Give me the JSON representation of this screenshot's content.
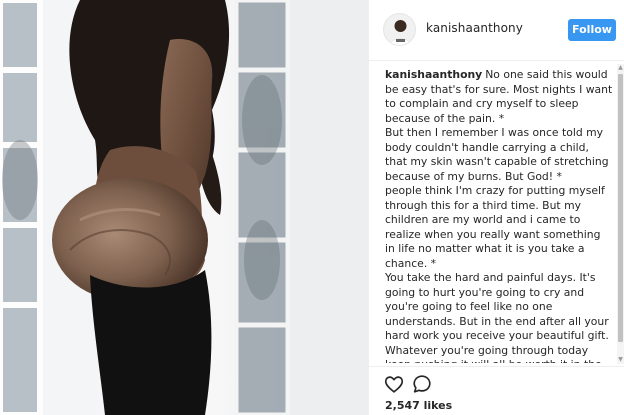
{
  "post": {
    "username": "kanishaanthony",
    "follow_label": "Follow",
    "caption": {
      "author": "kanishaanthony",
      "lines": [
        "No one said this would be easy that's for sure. Most nights I want to complain and cry myself to sleep because of the pain. *",
        "But then I remember I was once told my body couldn't handle carrying a child, that my skin wasn't capable of stretching because of my burns. But God! *",
        "people think I'm crazy for putting myself through this for a third time. But my children are my world and i came to realize when you really want something in life no matter what it is you take a chance. *",
        "You take the hard and painful days. It's going to hurt you're going to cry and you're going to feel like no one understands. But in the end after all your hard work you receive your beautiful gift. Whatever you're going through today keep pushing it will all be worth it in the end! ."
      ]
    },
    "likes": "2,547 likes"
  },
  "icons": {
    "like": "heart-icon",
    "comment": "comment-icon"
  },
  "colors": {
    "follow_bg": "#3897f0",
    "text": "#262626",
    "border": "#efefef"
  }
}
